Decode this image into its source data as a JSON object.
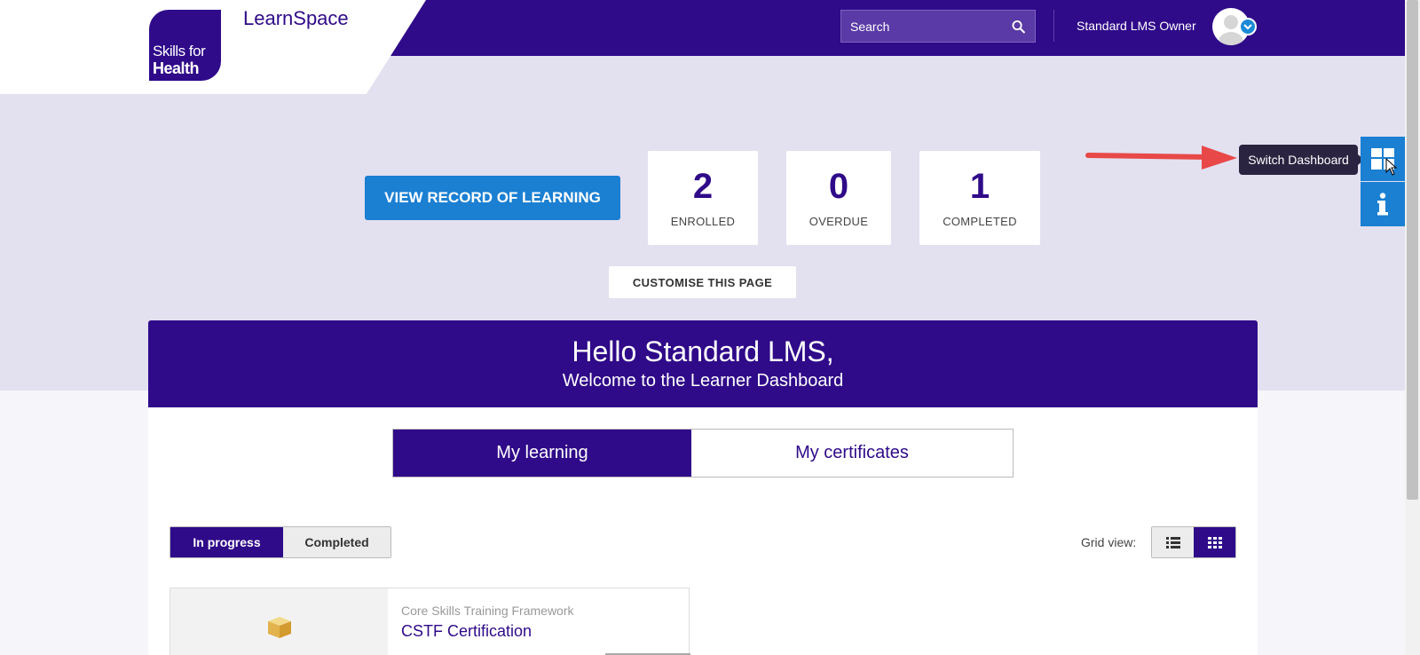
{
  "header": {
    "logo_line1": "Skills for",
    "logo_line2": "Health",
    "app_name": "LearnSpace",
    "search_placeholder": "Search",
    "user_name": "Standard LMS Owner"
  },
  "hero": {
    "record_button": "VIEW RECORD OF LEARNING",
    "stats": [
      {
        "value": "2",
        "label": "ENROLLED"
      },
      {
        "value": "0",
        "label": "OVERDUE"
      },
      {
        "value": "1",
        "label": "COMPLETED"
      }
    ],
    "customise_button": "CUSTOMISE THIS PAGE"
  },
  "side_tools": {
    "tooltip": "Switch Dashboard"
  },
  "welcome": {
    "hello": "Hello Standard LMS,",
    "subtitle": "Welcome to the Learner Dashboard"
  },
  "tabs": [
    {
      "label": "My learning",
      "active": true
    },
    {
      "label": "My certificates",
      "active": false
    }
  ],
  "filters": [
    {
      "label": "In progress",
      "active": true
    },
    {
      "label": "Completed",
      "active": false
    }
  ],
  "view": {
    "label": "Grid view:",
    "selected": "grid"
  },
  "courses": [
    {
      "framework": "Core Skills Training Framework",
      "title": "CSTF Certification"
    }
  ],
  "colors": {
    "brand": "#2f0a89",
    "accent": "#1b7fd2",
    "hero_bg": "#e3e0f0"
  }
}
